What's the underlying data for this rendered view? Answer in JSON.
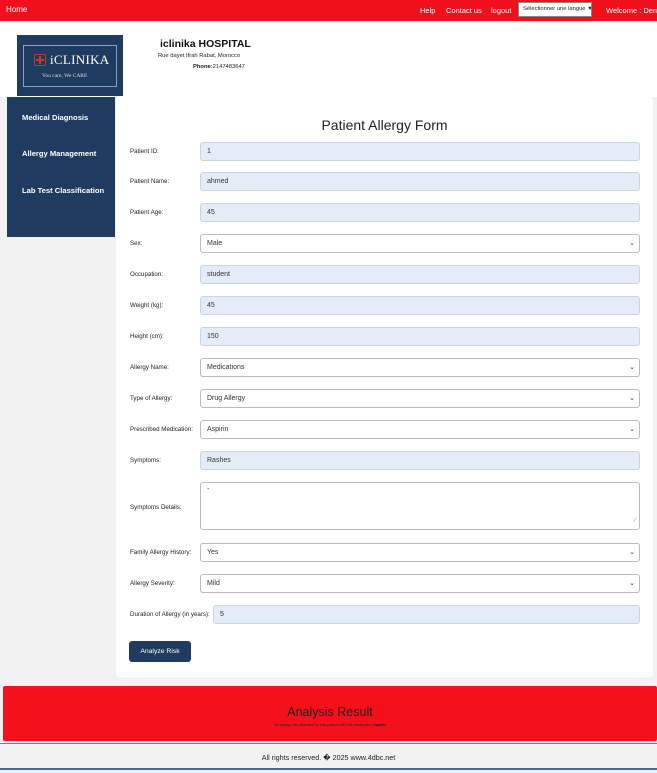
{
  "nav": {
    "home": "Home",
    "help": "Help",
    "contact": "Contact us",
    "logout": "logout",
    "language_select": "Sélectionner une langue",
    "welcome": "Welcome : Demo"
  },
  "header": {
    "logo_name": "iCLINIKA",
    "logo_tagline": "You care, We CARE",
    "hospital_name": "iclinika HOSPITAL",
    "address": "Rue dayet Ifrah Rabat, Morocco",
    "phone_label": "Phone:",
    "phone": "2147483647"
  },
  "sidebar": {
    "items": [
      "Medical Diagnosis",
      "Allergy Management",
      "Lab Test Classification"
    ]
  },
  "form": {
    "title": "Patient Allergy Form",
    "fields": [
      {
        "label": "Patient ID:",
        "value": "1",
        "kind": "input"
      },
      {
        "label": "Patient Name:",
        "value": "ahmed",
        "kind": "input"
      },
      {
        "label": "Patient Age:",
        "value": "45",
        "kind": "input"
      },
      {
        "label": "Sex:",
        "value": "Male",
        "kind": "select"
      },
      {
        "label": "Occupation:",
        "value": "student",
        "kind": "input"
      },
      {
        "label": "Weight (kg):",
        "value": "45",
        "kind": "input"
      },
      {
        "label": "Height (cm):",
        "value": "150",
        "kind": "input"
      },
      {
        "label": "Allergy Name:",
        "value": "Medications",
        "kind": "select"
      },
      {
        "label": "Type of Allergy:",
        "value": "Drug Allergy",
        "kind": "select"
      },
      {
        "label": "Prescribed Medication:",
        "value": "Aspirin",
        "kind": "select"
      },
      {
        "label": "Symptoms:",
        "value": "Rashes",
        "kind": "input"
      },
      {
        "label": "Symptoms Details:",
        "value": "-",
        "kind": "textarea"
      },
      {
        "label": "Family Allergy History:",
        "value": "Yes",
        "kind": "select"
      },
      {
        "label": "Allergy Severity:",
        "value": "Mild",
        "kind": "select"
      },
      {
        "label": "Duration of Allergy (in years):",
        "value": "5",
        "kind": "input"
      }
    ],
    "submit_label": "Analyze Risk"
  },
  "result": {
    "title": "Analysis Result",
    "message": "No allergy risk detected for this patient with the medication",
    "medication": "aspirin"
  },
  "footer": {
    "text": "All rights reserved. � 2025 www.4dbc.net"
  },
  "colors": {
    "nav_red": "#f0101c",
    "navy": "#1f3b5f",
    "field_bg": "#e4ecf7",
    "result_red": "#f4111c"
  }
}
